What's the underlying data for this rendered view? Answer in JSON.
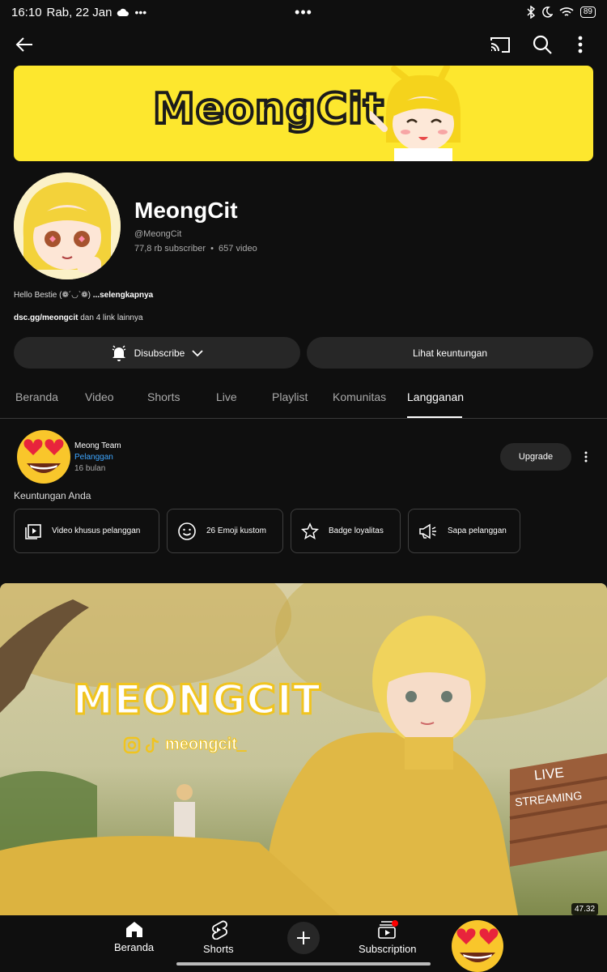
{
  "status_bar": {
    "time": "16:10",
    "date": "Rab, 22 Jan",
    "center_dots": "•••",
    "battery": "89"
  },
  "banner": {
    "logo_text": "MeongCit"
  },
  "channel": {
    "name": "MeongCit",
    "handle": "@MeongCit",
    "subscribers": "77,8 rb subscriber",
    "separator": "•",
    "videos": "657 video",
    "description": "Hello Bestie (❁´◡`❁)",
    "description_more": "...selengkapnya",
    "link": "dsc.gg/meongcit",
    "link_more": "dan 4 link lainnya"
  },
  "buttons": {
    "subscribe": "Disubscribe",
    "perks": "Lihat keuntungan",
    "upgrade": "Upgrade"
  },
  "tabs": [
    {
      "label": "Beranda"
    },
    {
      "label": "Video"
    },
    {
      "label": "Shorts"
    },
    {
      "label": "Live"
    },
    {
      "label": "Playlist"
    },
    {
      "label": "Komunitas"
    },
    {
      "label": "Langganan"
    }
  ],
  "membership": {
    "tier": "Meong Team",
    "status": "Pelanggan",
    "duration": "16 bulan",
    "perks_title": "Keuntungan Anda",
    "perks": [
      {
        "label": "Video khusus pelanggan",
        "icon": "video-library-icon"
      },
      {
        "label": "26 Emoji kustom",
        "icon": "smile-icon"
      },
      {
        "label": "Badge loyalitas",
        "icon": "star-icon"
      },
      {
        "label": "Sapa pelanggan",
        "icon": "megaphone-icon"
      }
    ]
  },
  "video": {
    "title_text": "MEONGCIT",
    "social_handle": "meongcit_",
    "bench_text_1": "LIVE",
    "bench_text_2": "STREAMING",
    "duration": "47.32"
  },
  "bottom_nav": {
    "home": "Beranda",
    "shorts": "Shorts",
    "subscription": "Subscription"
  },
  "colors": {
    "background": "#0f0f0f",
    "button": "#272727",
    "banner_yellow": "#fde72e",
    "link_blue": "#3ea6ff",
    "notification_red": "#ff0000"
  }
}
